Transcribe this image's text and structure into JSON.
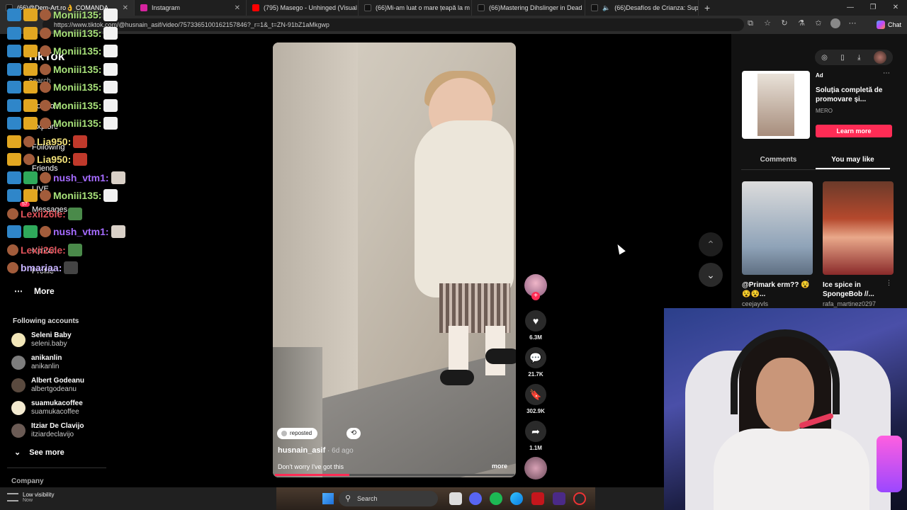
{
  "browser": {
    "tabs": [
      {
        "label": "(66)@Dem-Art.ro👌 COMANDA",
        "color": "#111111"
      },
      {
        "label": "Instagram",
        "color": "#d6249f"
      },
      {
        "label": "(795) Masego - Unhinged (Visual",
        "color": "#ff0000"
      },
      {
        "label": "(66)Mi-am luat o mare țeapă la m",
        "color": "#111111"
      },
      {
        "label": "(66)Mastering Dihslinger in Dead",
        "color": "#111111"
      },
      {
        "label": "(66)Desafíos de Crianza: Sup",
        "color": "#111111"
      }
    ],
    "new_tab": "+",
    "url": "https://www.tiktok.com/@husnain_asif/video/7573365100162157846?_r=1&_t=ZN-91bZ1aMkgwp",
    "chat_label": "Chat"
  },
  "nav": {
    "logo": "TikTok",
    "search": "Search",
    "items": [
      "For You",
      "Explore",
      "Following",
      "Friends",
      "LIVE",
      "Messages",
      "Upload",
      "Profile"
    ],
    "messages_badge": "57",
    "more": "More",
    "following_title": "Following accounts",
    "accounts": [
      {
        "name": "Seleni Baby",
        "handle": "seleni.baby",
        "color": "#f2e6b8"
      },
      {
        "name": "anikanlin",
        "handle": "anikanlin",
        "color": "#7d7d7d"
      },
      {
        "name": "Albert Godeanu",
        "handle": "albertgodeanu",
        "color": "#5a4a3f"
      },
      {
        "name": "suamukacoffee",
        "handle": "suamukacoffee",
        "color": "#f3ead0"
      },
      {
        "name": "Itziar De Clavijo",
        "handle": "itziardeclavijo",
        "color": "#6b5b55"
      }
    ],
    "see_more": "See more",
    "company": "Company"
  },
  "stream_chat": [
    {
      "user": "Moniii135:",
      "color": "#a8e27a"
    },
    {
      "user": "Moniii135:",
      "color": "#a8e27a"
    },
    {
      "user": "Moniii135:",
      "color": "#a8e27a"
    },
    {
      "user": "Moniii135:",
      "color": "#a8e27a"
    },
    {
      "user": "Moniii135:",
      "color": "#a8e27a"
    },
    {
      "user": "Moniii135:",
      "color": "#a8e27a"
    },
    {
      "user": "Moniii135:",
      "color": "#a8e27a"
    },
    {
      "user": "Lia950:",
      "color": "#f3e27a"
    },
    {
      "user": "Lia950:",
      "color": "#f3e27a"
    },
    {
      "user": "nush_vtm1:",
      "color": "#a56bff"
    },
    {
      "user": "Moniii135:",
      "color": "#a8e27a"
    },
    {
      "user": "Lexii26le:",
      "color": "#e0525a"
    },
    {
      "user": "nush_vtm1:",
      "color": "#a56bff"
    },
    {
      "user": "Lexii26le:",
      "color": "#e0525a"
    },
    {
      "user": "bmariaa:",
      "color": "#c7b3ff"
    }
  ],
  "video": {
    "reposted_by": "reposted",
    "author": "husnain_asif",
    "time": " · 6d ago",
    "caption": "Don't worry I've got this",
    "more": "more",
    "progress": 0.31
  },
  "actions": {
    "likes": "6.3M",
    "comments": "21.7K",
    "saves": "302.9K",
    "shares": "1.1M"
  },
  "ad": {
    "tag": "Ad",
    "title": "Soluția completă de promovare și...",
    "brand": "MERO",
    "cta": "Learn more"
  },
  "side_tabs": {
    "comments": "Comments",
    "you_may_like": "You may like"
  },
  "recommendations": [
    {
      "title": "@Primark erm?? 😵😵😵...",
      "author": "ceejayvls"
    },
    {
      "title": "Ice spice in SpongeBob //...",
      "author": "rafa_martinez0297"
    }
  ],
  "taskbar": {
    "weather_title": "Low visibility",
    "weather_sub": "Now",
    "search": "Search"
  },
  "colors": {
    "accent": "#fe2c55",
    "background": "#000000"
  }
}
